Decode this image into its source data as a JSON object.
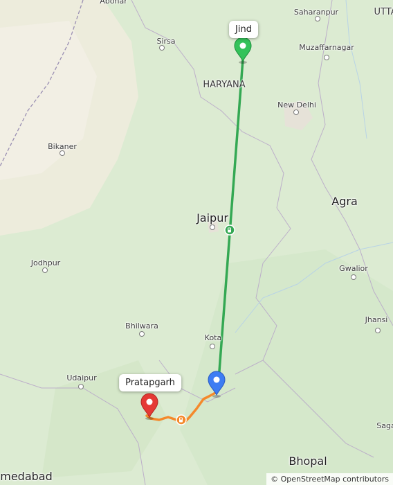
{
  "map": {
    "attribution": "© OpenStreetMap contributors",
    "colors": {
      "land": "#dcebd2",
      "desert": "#f0ede0",
      "urban": "#e8e4dc",
      "primary_route": "#34a853",
      "secondary_route": "#f4892b",
      "origin_pin": "#34c25a",
      "waypoint_pin": "#3d7df3",
      "destination_pin": "#e53935"
    },
    "places": [
      {
        "name": "Abohar",
        "size": "small"
      },
      {
        "name": "Saharanpur",
        "size": "small"
      },
      {
        "name": "UTTA",
        "size": "medium"
      },
      {
        "name": "Sirsa",
        "size": "small"
      },
      {
        "name": "Muzaffarnagar",
        "size": "small"
      },
      {
        "name": "HARYANA",
        "size": "state"
      },
      {
        "name": "New Delhi",
        "size": "small"
      },
      {
        "name": "Bikaner",
        "size": "small"
      },
      {
        "name": "Agra",
        "size": "large"
      },
      {
        "name": "Jaipur",
        "size": "large"
      },
      {
        "name": "Jodhpur",
        "size": "small"
      },
      {
        "name": "Gwalior",
        "size": "small"
      },
      {
        "name": "Bhilwara",
        "size": "small"
      },
      {
        "name": "Jhansi",
        "size": "small"
      },
      {
        "name": "Kota",
        "size": "small"
      },
      {
        "name": "Udaipur",
        "size": "small"
      },
      {
        "name": "Saga",
        "size": "small"
      },
      {
        "name": "Bhopal",
        "size": "large"
      },
      {
        "name": "medabad",
        "size": "large"
      }
    ],
    "markers": {
      "origin": {
        "label": "Jind",
        "icon": "map-pin-icon"
      },
      "waypoint": {
        "icon": "map-pin-icon"
      },
      "destination": {
        "label": "Pratapgarh",
        "icon": "map-pin-icon"
      }
    },
    "route_icons": [
      "fuel-station-icon",
      "fuel-station-icon"
    ]
  }
}
